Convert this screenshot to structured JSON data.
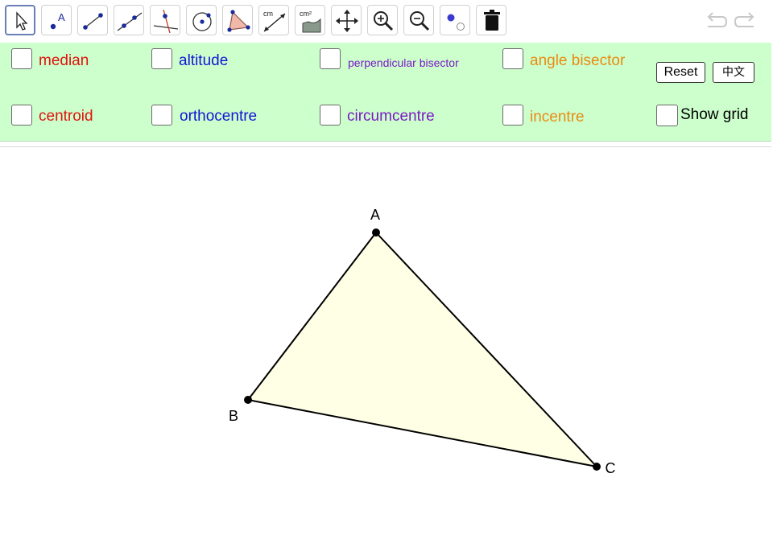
{
  "toolbar": {
    "tools": [
      {
        "name": "move-tool",
        "icon": "cursor-arrow-icon",
        "selected": true
      },
      {
        "name": "point-tool",
        "icon": "point-label-icon",
        "icon_label": "A"
      },
      {
        "name": "segment-tool",
        "icon": "segment-icon"
      },
      {
        "name": "line-tool",
        "icon": "line-icon"
      },
      {
        "name": "perpendicular-line-tool",
        "icon": "perpendicular-line-icon"
      },
      {
        "name": "circle-tool",
        "icon": "circle-center-point-icon"
      },
      {
        "name": "polygon-tool",
        "icon": "polygon-icon"
      },
      {
        "name": "distance-tool",
        "icon": "distance-length-icon",
        "icon_label": "cm"
      },
      {
        "name": "area-tool",
        "icon": "area-icon",
        "icon_label": "cm²"
      },
      {
        "name": "move-graphics-view-tool",
        "icon": "move-arrows-icon"
      },
      {
        "name": "zoom-in-tool",
        "icon": "zoom-in-icon"
      },
      {
        "name": "zoom-out-tool",
        "icon": "zoom-out-icon"
      },
      {
        "name": "show-hide-object-tool",
        "icon": "show-hide-icon"
      },
      {
        "name": "delete-tool",
        "icon": "trash-icon"
      }
    ],
    "undo_icon": "undo-icon",
    "redo_icon": "redo-icon"
  },
  "options": {
    "row1": [
      {
        "label": "median",
        "color": "#e0140f"
      },
      {
        "label": "altitude",
        "color": "#1515d6"
      },
      {
        "label": "perpendicular bisector",
        "color": "#7d19c8"
      },
      {
        "label": "angle bisector",
        "color": "#ea8a12"
      }
    ],
    "row2": [
      {
        "label": "centroid",
        "color": "#e0140f"
      },
      {
        "label": "orthocentre",
        "color": "#1515d6"
      },
      {
        "label": "circumcentre",
        "color": "#7d19c8"
      },
      {
        "label": "incentre",
        "color": "#ea8a12"
      }
    ],
    "reset_label": "Reset",
    "language_label": "中文",
    "show_grid_label": "Show grid"
  },
  "triangle": {
    "fill": "#ffffe6",
    "points": [
      {
        "label": "A"
      },
      {
        "label": "B"
      },
      {
        "label": "C"
      }
    ]
  }
}
